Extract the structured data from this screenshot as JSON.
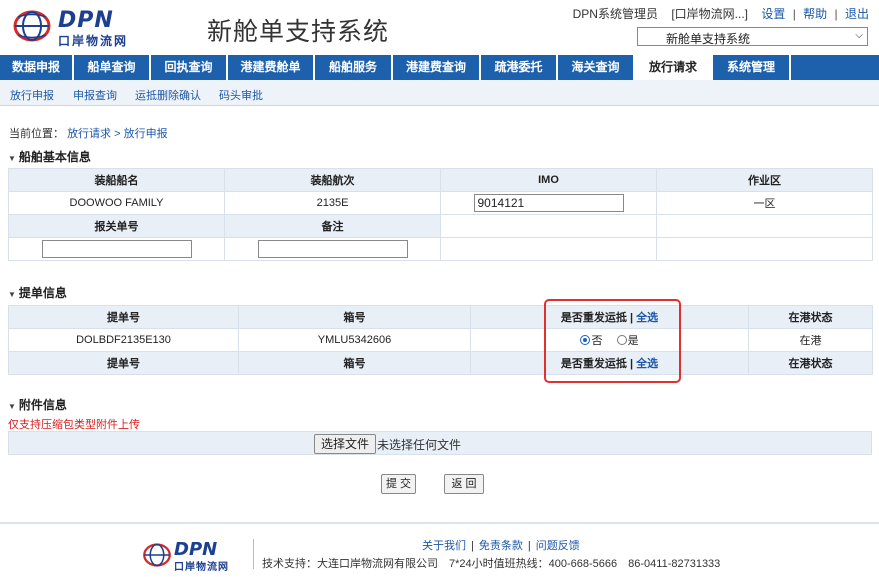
{
  "header": {
    "logo_brand": "DPN",
    "logo_sub": "口岸物流网",
    "app_title": "新舱单支持系统",
    "user": "DPN系统管理员",
    "org": "[口岸物流网...]",
    "links": [
      "设置",
      "帮助",
      "退出"
    ],
    "system_select": "新舱单支持系统"
  },
  "main_nav": [
    {
      "label": "数据申报"
    },
    {
      "label": "船单查询"
    },
    {
      "label": "回执查询"
    },
    {
      "label": "港建费舱单"
    },
    {
      "label": "船舶服务"
    },
    {
      "label": "港建费查询"
    },
    {
      "label": "疏港委托"
    },
    {
      "label": "海关查询"
    },
    {
      "label": "放行请求",
      "active": true
    },
    {
      "label": "系统管理"
    }
  ],
  "sub_nav": [
    "放行申报",
    "申报查询",
    "运抵删除确认",
    "码头审批"
  ],
  "breadcrumb": {
    "prefix": "当前位置：",
    "path": "放行请求 > 放行申报"
  },
  "vessel_section": {
    "title": "船舶基本信息",
    "headers": [
      "装船船名",
      "装船航次",
      "IMO",
      "作业区"
    ],
    "row": {
      "ship_name": "DOOWOO FAMILY",
      "voyage": "2135E",
      "imo": "9014121",
      "zone": "一区"
    },
    "headers2": [
      "报关单号",
      "备注"
    ],
    "customs_no": "",
    "remark": ""
  },
  "bill_section": {
    "title": "提单信息",
    "headers": [
      "提单号",
      "箱号",
      "是否重发运抵",
      "全选",
      "在港状态"
    ],
    "row": {
      "bill_no": "DOLBDF2135E130",
      "container": "YMLU5342606",
      "radio_no": "否",
      "radio_yes": "是",
      "selected": "否",
      "status": "在港"
    }
  },
  "attachment_section": {
    "title": "附件信息",
    "warning": "仅支持压缩包类型附件上传",
    "choose_file": "选择文件",
    "no_file": "未选择任何文件"
  },
  "actions": {
    "submit": "提 交",
    "back": "返 回"
  },
  "footer": {
    "links": [
      "关于我们",
      "免责条款",
      "问题反馈"
    ],
    "support": "技术支持：大连口岸物流网有限公司　7*24小时值班热线：400-668-5666　86-0411-82731333"
  },
  "colors": {
    "nav": "#1d61ad",
    "brand": "#1d3f8f",
    "link": "#1d57a8",
    "highlight": "#e03030",
    "warning": "#d42020"
  }
}
